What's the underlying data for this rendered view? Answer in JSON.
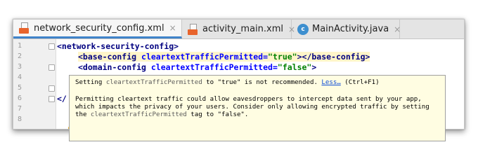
{
  "tabs": [
    {
      "label": "network_security_config.xml",
      "icon": "xml-file-icon",
      "active": true
    },
    {
      "label": "activity_main.xml",
      "icon": "xml-file-icon",
      "active": false
    },
    {
      "label": "MainActivity.java",
      "icon": "java-class-icon",
      "active": false
    }
  ],
  "tab_close_glyph": "×",
  "java_icon_letter": "c",
  "colors": {
    "accent": "#4083c9",
    "tooltip_bg": "#fffde2",
    "highlight": "#fff5c9",
    "tag": "#000080",
    "attr": "#0000ff",
    "value": "#008000"
  },
  "editor": {
    "line_numbers": [
      "1",
      "2",
      "3",
      "4",
      "5",
      "6",
      "7",
      "8"
    ],
    "line1": {
      "tag": "<network-security-config>"
    },
    "line2": {
      "open": "<base-config ",
      "attr": "cleartextTrafficPermitted",
      "eq": "=",
      "value": "\"true\"",
      "close": "></base-config>"
    },
    "line3": {
      "open": "<domain-config ",
      "attr": "cleartextTrafficPermitted",
      "eq": "=",
      "value": "\"false\"",
      "close": ">"
    },
    "line6_partial": "</"
  },
  "tooltip": {
    "l1_pre": "Setting ",
    "l1_code": "cleartextTrafficPermitted",
    "l1_post": " to \"true\" is not recommended. ",
    "link": "Less…",
    "shortcut": " (Ctrl+F1)",
    "p1": "Permitting cleartext traffic could allow eavesdroppers to intercept data sent by your app,",
    "p2": "which impacts the privacy of your users. Consider only allowing encrypted traffic by setting",
    "p3_pre": "the ",
    "p3_code": "cleartextTrafficPermitted",
    "p3_post": " tag to \"false\"."
  }
}
